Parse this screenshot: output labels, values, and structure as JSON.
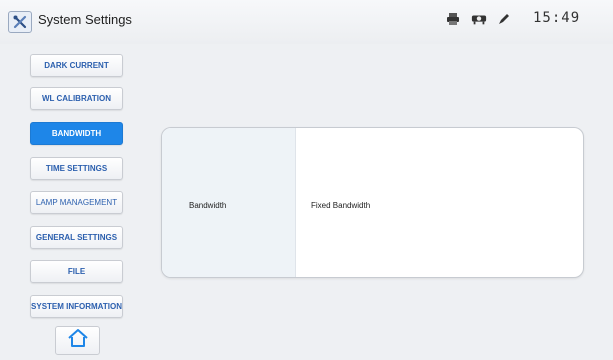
{
  "header": {
    "title": "System Settings",
    "clock": "15:49",
    "status_icons": [
      "printer-icon",
      "projector-icon",
      "pen-icon"
    ]
  },
  "menu": [
    {
      "label": "DARK CURRENT",
      "active": false
    },
    {
      "label": "WL CALIBRATION",
      "active": false
    },
    {
      "label": "BANDWIDTH",
      "active": true
    },
    {
      "label": "TIME SETTINGS",
      "active": false
    },
    {
      "label": "LAMP MANAGEMENT",
      "active": false
    },
    {
      "label": "GENERAL SETTINGS",
      "active": false
    },
    {
      "label": "FILE",
      "active": false
    },
    {
      "label": "SYSTEM INFORMATION",
      "active": false
    }
  ],
  "home_icon": "home-icon",
  "panel": {
    "label": "Bandwidth",
    "value": "Fixed Bandwidth"
  },
  "colors": {
    "accent": "#1e86e8",
    "menu_text": "#2b5fae",
    "background": "#eef0f3"
  }
}
